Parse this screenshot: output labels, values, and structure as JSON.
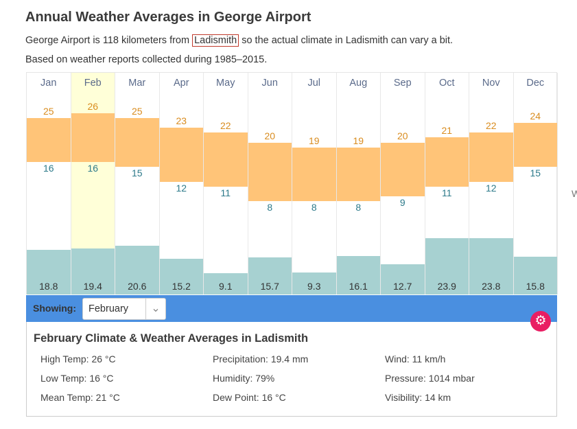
{
  "title": "Annual Weather Averages in George Airport",
  "intro": {
    "before": "George Airport is 118 kilometers from ",
    "link": "Ladismith",
    "after": " so the actual climate in Ladismith can vary a bit."
  },
  "basis": "Based on weather reports collected during 1985–2015.",
  "chart_data": {
    "type": "bar",
    "categories": [
      "Jan",
      "Feb",
      "Mar",
      "Apr",
      "May",
      "Jun",
      "Jul",
      "Aug",
      "Sep",
      "Oct",
      "Nov",
      "Dec"
    ],
    "series": [
      {
        "name": "high",
        "values": [
          25,
          26,
          25,
          23,
          22,
          20,
          19,
          19,
          20,
          21,
          22,
          24
        ]
      },
      {
        "name": "low",
        "values": [
          16,
          16,
          15,
          12,
          11,
          8,
          8,
          8,
          9,
          11,
          12,
          15
        ]
      },
      {
        "name": "precipitation",
        "values": [
          18.8,
          19.4,
          20.6,
          15.2,
          9.1,
          15.7,
          9.3,
          16.1,
          12.7,
          23.9,
          23.8,
          15.8
        ]
      }
    ],
    "highlighted": "Feb",
    "colors": {
      "temp_range": "#ffc478",
      "precip": "#a7d1d1",
      "highlight": "#ffffd8"
    }
  },
  "showing": {
    "label": "Showing:",
    "selected": "February"
  },
  "details": {
    "title": "February Climate & Weather Averages in Ladismith",
    "fields": [
      "High Temp: 26 °C",
      "Precipitation: 19.4 mm",
      "Wind: 11 km/h",
      "Low Temp: 16 °C",
      "Humidity: 79%",
      "Pressure: 1014 mbar",
      "Mean Temp: 21 °C",
      "Dew Point: 16 °C",
      "Visibility: 14 km"
    ]
  },
  "side_text": "W",
  "icons": {
    "settings": "gear-icon",
    "dropdown": "chevron-down-icon"
  }
}
